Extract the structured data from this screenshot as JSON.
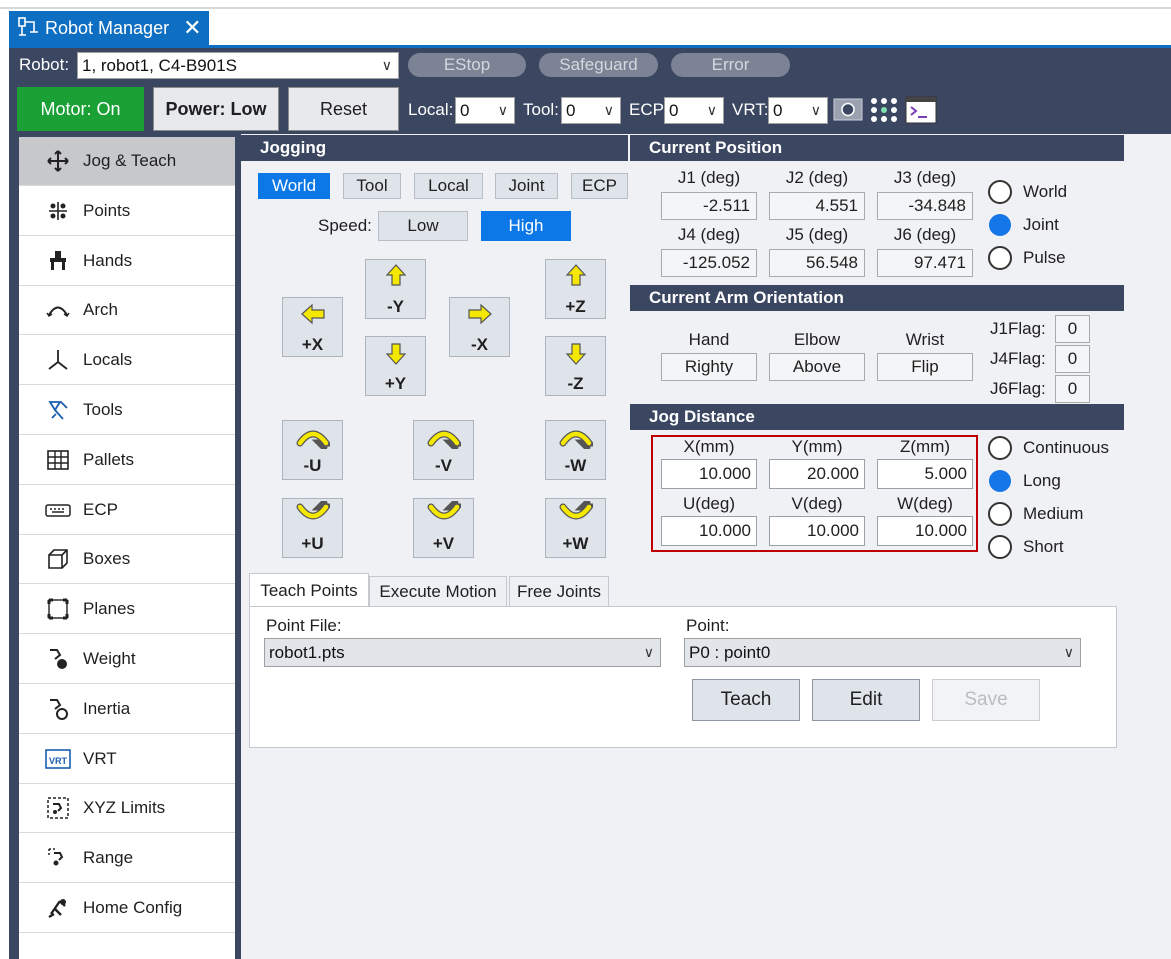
{
  "title_tab": {
    "title": "Robot Manager",
    "close": "✕",
    "icon": "robot-manager-icon"
  },
  "toolbar": {
    "robot_label": "Robot:",
    "robot_value": "1, robot1, C4-B901S",
    "estop": "EStop",
    "safeguard": "Safeguard",
    "error": "Error",
    "motor": "Motor: On",
    "power": "Power: Low",
    "reset": "Reset",
    "local_label": "Local:",
    "local_value": "0",
    "tool_label": "Tool:",
    "tool_value": "0",
    "ecp_label": "ECP:",
    "ecp_value": "0",
    "vrt_label": "VRT:",
    "vrt_value": "0",
    "motor_color": "#1aa035"
  },
  "sidebar": {
    "items": [
      {
        "label": "Jog & Teach",
        "icon": "move-arrows-icon"
      },
      {
        "label": "Points",
        "icon": "points-icon"
      },
      {
        "label": "Hands",
        "icon": "hand-gripper-icon"
      },
      {
        "label": "Arch",
        "icon": "arch-icon"
      },
      {
        "label": "Locals",
        "icon": "axes-icon"
      },
      {
        "label": "Tools",
        "icon": "tool-icon"
      },
      {
        "label": "Pallets",
        "icon": "grid-icon"
      },
      {
        "label": "ECP",
        "icon": "keyboard-icon"
      },
      {
        "label": "Boxes",
        "icon": "box-icon"
      },
      {
        "label": "Planes",
        "icon": "plane-icon"
      },
      {
        "label": "Weight",
        "icon": "weight-icon"
      },
      {
        "label": "Inertia",
        "icon": "inertia-icon"
      },
      {
        "label": "VRT",
        "icon": "vrt-icon"
      },
      {
        "label": "XYZ Limits",
        "icon": "xyz-limits-icon"
      },
      {
        "label": "Range",
        "icon": "range-icon"
      },
      {
        "label": "Home Config",
        "icon": "home-config-icon"
      }
    ]
  },
  "jogging": {
    "header": "Jogging",
    "modes": [
      "World",
      "Tool",
      "Local",
      "Joint",
      "ECP"
    ],
    "speed_label": "Speed:",
    "speed_low": "Low",
    "speed_high": "High",
    "buttons": {
      "ny": "-Y",
      "py": "+Y",
      "px": "+X",
      "nx": "-X",
      "pz": "+Z",
      "nz": "-Z",
      "nu": "-U",
      "nv": "-V",
      "nw": "-W",
      "pu": "+U",
      "pv": "+V",
      "pw": "+W"
    }
  },
  "current_position": {
    "header": "Current Position",
    "labels": [
      "J1 (deg)",
      "J2 (deg)",
      "J3 (deg)",
      "J4 (deg)",
      "J5 (deg)",
      "J6 (deg)"
    ],
    "values": [
      "-2.511",
      "4.551",
      "-34.848",
      "-125.052",
      "56.548",
      "97.471"
    ],
    "modes": [
      "World",
      "Joint",
      "Pulse"
    ],
    "selected": "Joint"
  },
  "arm_orientation": {
    "header": "Current Arm Orientation",
    "hand_label": "Hand",
    "hand": "Righty",
    "elbow_label": "Elbow",
    "elbow": "Above",
    "wrist_label": "Wrist",
    "wrist": "Flip",
    "j1flag_label": "J1Flag:",
    "j1flag": "0",
    "j4flag_label": "J4Flag:",
    "j4flag": "0",
    "j6flag_label": "J6Flag:",
    "j6flag": "0"
  },
  "jog_distance": {
    "header": "Jog Distance",
    "labels": [
      "X(mm)",
      "Y(mm)",
      "Z(mm)",
      "U(deg)",
      "V(deg)",
      "W(deg)"
    ],
    "values": [
      "10.000",
      "20.000",
      "5.000",
      "10.000",
      "10.000",
      "10.000"
    ],
    "modes": [
      "Continuous",
      "Long",
      "Medium",
      "Short"
    ],
    "selected": "Long"
  },
  "teach": {
    "tabs": [
      "Teach Points",
      "Execute Motion",
      "Free Joints"
    ],
    "point_file_label": "Point File:",
    "point_file": "robot1.pts",
    "point_label": "Point:",
    "point": "P0 : point0",
    "teach": "Teach",
    "edit": "Edit",
    "save": "Save"
  }
}
